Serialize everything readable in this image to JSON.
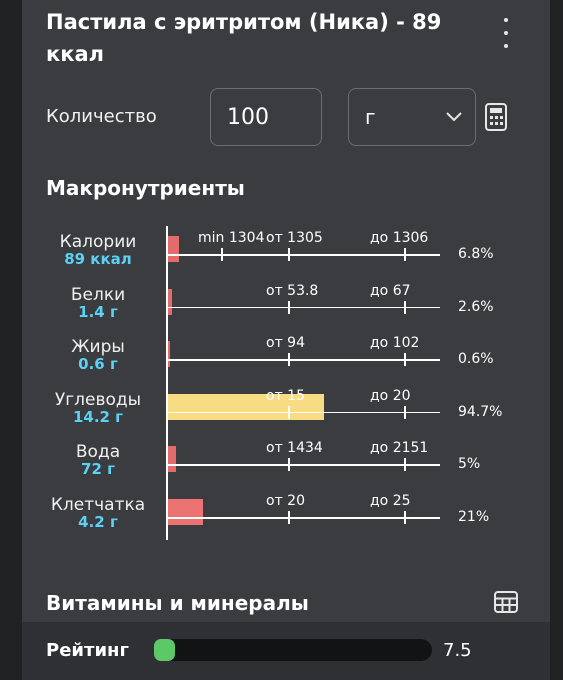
{
  "food": {
    "title": "Пастила с эритритом (Ника) - 89 ккал"
  },
  "quantity": {
    "label": "Количество",
    "value": "100",
    "unit": "г"
  },
  "macros": {
    "title": "Макронутриенты",
    "items": [
      {
        "name": "Калории",
        "value": "89 ккал",
        "left_label": "min 1304",
        "from_label": "от 1305",
        "to_label": "до 1306",
        "percent": "6.8%",
        "fraction": 0.068,
        "color": "#e36b6b"
      },
      {
        "name": "Белки",
        "value": "1.4 г",
        "from_label": "от 53.8",
        "to_label": "до 67",
        "percent": "2.6%",
        "fraction": 0.026,
        "color": "#e36b6b"
      },
      {
        "name": "Жиры",
        "value": "0.6 г",
        "from_label": "от 94",
        "to_label": "до 102",
        "percent": "0.6%",
        "fraction": 0.006,
        "color": "#e36b6b"
      },
      {
        "name": "Углеводы",
        "value": "14.2 г",
        "from_label": "от 15",
        "to_label": "до 20",
        "percent": "94.7%",
        "fraction": 0.947,
        "color": "#f7dc84"
      },
      {
        "name": "Вода",
        "value": "72 г",
        "from_label": "от 1434",
        "to_label": "до 2151",
        "percent": "5%",
        "fraction": 0.05,
        "color": "#e36b6b"
      },
      {
        "name": "Клетчатка",
        "value": "4.2 г",
        "from_label": "от 20",
        "to_label": "до 25",
        "percent": "21%",
        "fraction": 0.21,
        "color": "#ed7373"
      }
    ]
  },
  "vitamins": {
    "title": "Витамины и минералы"
  },
  "rating": {
    "label": "Рейтинг",
    "value": "7.5",
    "fraction": 0.075,
    "color": "#5cc866"
  },
  "icons": {
    "more": "more-vertical-icon",
    "calculator": "calculator-icon",
    "chevron": "chevron-down-icon",
    "table": "table-grid-icon"
  }
}
